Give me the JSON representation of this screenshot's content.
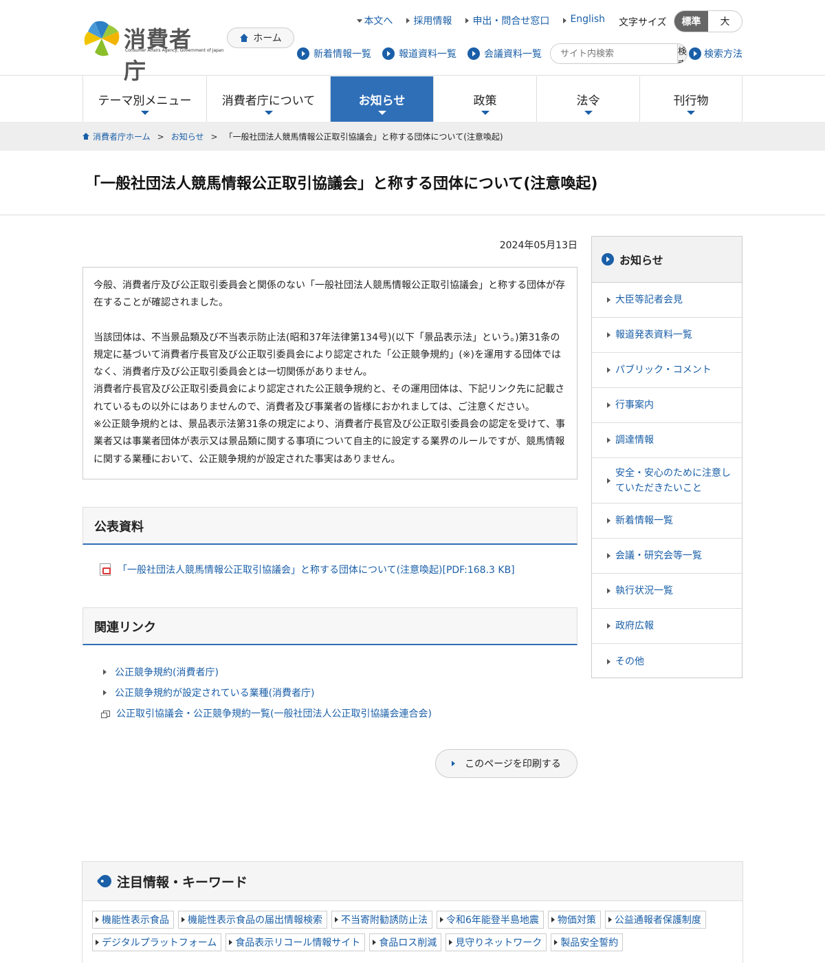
{
  "header": {
    "logo_text": "消費者庁",
    "logo_sub": "Consumer Affairs Agency, Government of Japan",
    "home_label": "ホーム",
    "top_links": [
      "本文へ",
      "採用情報",
      "申出・問合せ窓口",
      "English"
    ],
    "font_size_label": "文字サイズ",
    "font_standard": "標準",
    "font_large": "大",
    "sub_links": [
      "新着情報一覧",
      "報道資料一覧",
      "会議資料一覧"
    ],
    "search_placeholder": "サイト内検索",
    "search_button": "検索",
    "search_help": "検索方法"
  },
  "gnav": [
    "テーマ別メニュー",
    "消費者庁について",
    "お知らせ",
    "政策",
    "法令",
    "刊行物"
  ],
  "breadcrumb": [
    "消費者庁ホーム",
    "お知らせ",
    "「一般社団法人競馬情報公正取引協議会」と称する団体について(注意喚起)"
  ],
  "page_title": "「一般社団法人競馬情報公正取引協議会」と称する団体について(注意喚起)",
  "date": "2024年05月13日",
  "lead": {
    "p1": "今般、消費者庁及び公正取引委員会と関係のない「一般社団法人競馬情報公正取引協議会」と称する団体が存在することが確認されました。",
    "p2": "当該団体は、不当景品類及び不当表示防止法(昭和37年法律第134号)(以下「景品表示法」という。)第31条の規定に基づいて消費者庁長官及び公正取引委員会により認定された「公正競争規約」(※)を運用する団体ではなく、消費者庁及び公正取引委員会とは一切関係がありません。",
    "p3": "消費者庁長官及び公正取引委員会により認定された公正競争規約と、その運用団体は、下記リンク先に記載されているもの以外にはありませんので、消費者及び事業者の皆様におかれましては、ご注意ください。",
    "p4": "※公正競争規約とは、景品表示法第31条の規定により、消費者庁長官及び公正取引委員会の認定を受けて、事業者又は事業者団体が表示又は景品類に関する事項について自主的に設定する業界のルールですが、競馬情報に関する業種において、公正競争規約が設定された事実はありません。"
  },
  "public_docs": {
    "heading": "公表資料",
    "pdf_link": "「一般社団法人競馬情報公正取引協議会」と称する団体について(注意喚起)[PDF:168.3 KB]"
  },
  "related": {
    "heading": "関連リンク",
    "links": [
      "公正競争規約(消費者庁)",
      "公正競争規約が設定されている業種(消費者庁)",
      "公正取引協議会・公正競争規約一覧(一般社団法人公正取引協議会連合会)"
    ]
  },
  "print_label": "このページを印刷する",
  "sidebar": {
    "heading": "お知らせ",
    "items": [
      "大臣等記者会見",
      "報道発表資料一覧",
      "パブリック・コメント",
      "行事案内",
      "調達情報",
      "安全・安心のために注意していただきたいこと",
      "新着情報一覧",
      "会議・研究会等一覧",
      "執行状況一覧",
      "政府広報",
      "その他"
    ]
  },
  "keywords": {
    "heading": "注目情報・キーワード",
    "items": [
      "機能性表示食品",
      "機能性表示食品の届出情報検索",
      "不当寄附勧誘防止法",
      "令和6年能登半島地震",
      "物価対策",
      "公益通報者保護制度",
      "デジタルプラットフォーム",
      "食品表示リコール情報サイト",
      "食品ロス削減",
      "見守りネットワーク",
      "製品安全誓約"
    ]
  },
  "colors": {
    "accent": "#2f6fb8",
    "link": "#1a5fa8"
  }
}
